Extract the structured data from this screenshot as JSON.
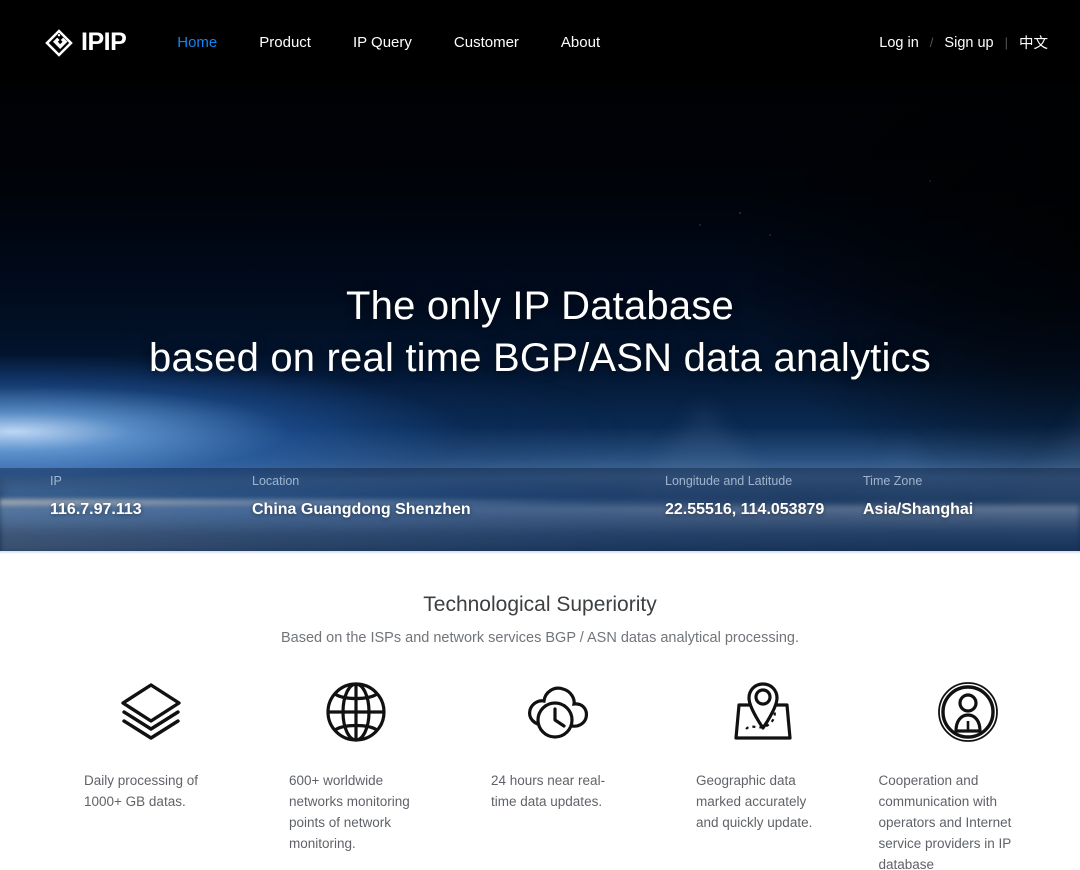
{
  "nav": {
    "logo": {
      "icon": "ipip-diamond-logo-icon",
      "text": "IPIP"
    },
    "links": [
      {
        "label": "Home",
        "active": true
      },
      {
        "label": "Product",
        "active": false
      },
      {
        "label": "IP Query",
        "active": false
      },
      {
        "label": "Customer",
        "active": false
      },
      {
        "label": "About",
        "active": false
      }
    ],
    "login_label": "Log in",
    "separator": "/",
    "signup_label": "Sign up",
    "separator2": "|",
    "lang_label": "中文",
    "active_color": "#0f86f5",
    "background_color": "#000000"
  },
  "hero": {
    "title_line1": "The only IP Database",
    "title_line2": "based on real time BGP/ASN data analytics"
  },
  "ip_bar": {
    "fields": [
      {
        "label": "IP",
        "value": "116.7.97.113"
      },
      {
        "label": "Location",
        "value": "China Guangdong Shenzhen"
      },
      {
        "label": "Longitude and Latitude",
        "value": "22.55516, 114.053879"
      },
      {
        "label": "Time Zone",
        "value": "Asia/Shanghai"
      }
    ]
  },
  "features_section": {
    "title": "Technological Superiority",
    "subtitle": "Based on the ISPs and network services BGP / ASN datas analytical processing.",
    "items": [
      {
        "icon": "layers-stack-icon",
        "caption": "Daily processing of 1000+ GB datas."
      },
      {
        "icon": "globe-grid-icon",
        "caption": "600+ worldwide networks monitoring points of network monitoring."
      },
      {
        "icon": "cloud-clock-icon",
        "caption": "24 hours near real-time data updates."
      },
      {
        "icon": "map-pin-icon",
        "caption": "Geographic data marked accurately and quickly update."
      },
      {
        "icon": "user-circle-icon",
        "caption": "Cooperation and communication with operators and Internet service providers in IP database"
      }
    ]
  }
}
